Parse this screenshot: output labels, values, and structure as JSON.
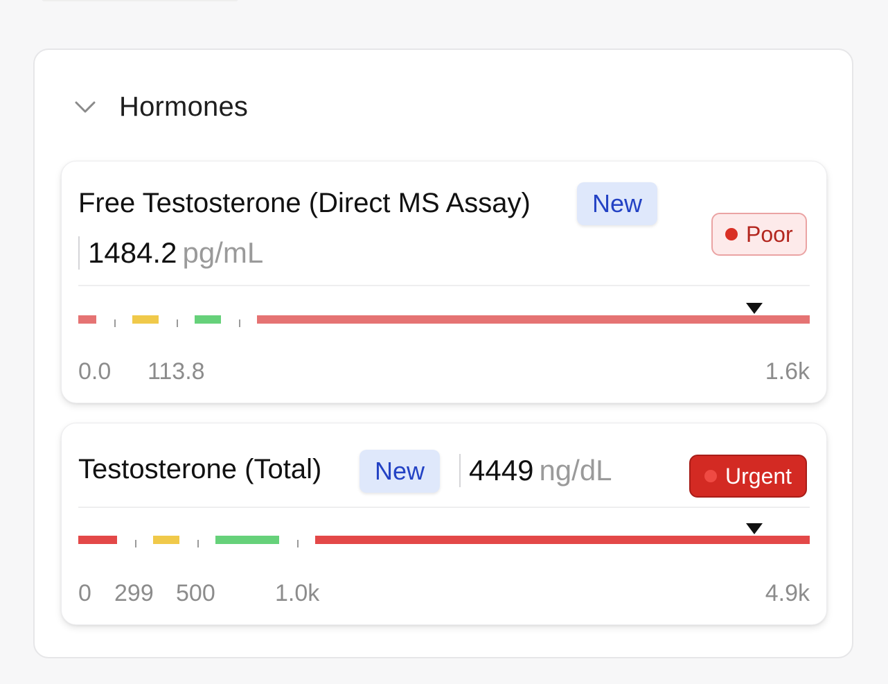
{
  "section": {
    "title": "Hormones",
    "chevron_icon": "chevron-down-icon"
  },
  "biomarkers": [
    {
      "name": "Free Testosterone (Direct MS Assay)",
      "badge": "New",
      "value": "1484.2",
      "unit": "pg/mL",
      "status": "Poor",
      "status_color": "#d93025",
      "range": {
        "axis_labels": [
          "0.0",
          "113.8",
          "1.6k"
        ],
        "segment_colors": [
          "#e57373",
          "#f0c94a",
          "#66d17a",
          "#e57373"
        ],
        "marker_value": 1484.2
      }
    },
    {
      "name": "Testosterone (Total)",
      "badge": "New",
      "value": "4449",
      "unit": "ng/dL",
      "status": "Urgent",
      "status_color": "#d32a23",
      "range": {
        "axis_labels": [
          "0",
          "299",
          "500",
          "1.0k",
          "4.9k"
        ],
        "segment_colors": [
          "#e34848",
          "#f0c94a",
          "#66d17a",
          "#e34848"
        ],
        "marker_value": 4449
      }
    }
  ]
}
